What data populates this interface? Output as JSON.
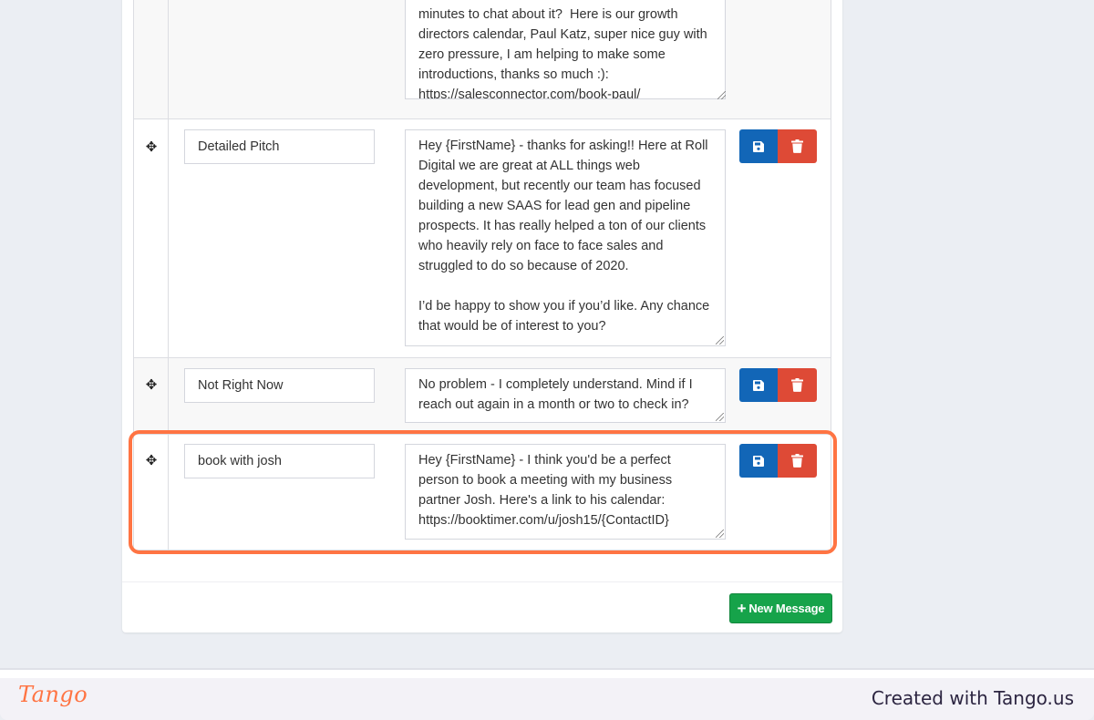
{
  "messages": [
    {
      "name": "",
      "body": "minutes to chat about it?  Here is our growth\ndirectors calendar, Paul Katz, super nice guy with\nzero pressure, I am helping to make some\nintroductions, thanks so much :):\nhttps://salesconnector.com/book-paul/"
    },
    {
      "name": "Detailed Pitch",
      "body": "Hey {FirstName} - thanks for asking!! Here at Roll Digital we are great at ALL things web development, but recently our team has focused building a new SAAS for lead gen and pipeline prospects. It has really helped a ton of our clients who heavily rely on face to face sales and struggled to do so because of 2020.\n\nI’d be happy to show you if you’d like. Any chance that would be of interest to you?"
    },
    {
      "name": "Not Right Now",
      "body": "No problem - I completely understand. Mind if I reach out again in a month or two to check in?"
    },
    {
      "name": "book with josh",
      "body": "Hey {FirstName} - I think you'd be a perfect person to book a meeting with my business partner Josh. Here's a link to his calendar: https://booktimer.com/u/josh15/{ContactID}"
    }
  ],
  "icons": {
    "move": "move-arrows-icon",
    "save": "floppy-disk-icon",
    "delete": "trash-icon",
    "add": "plus-icon"
  },
  "buttons": {
    "new_message": "New Message",
    "new_message_plus": "+"
  },
  "footer": {
    "logo": "Tango",
    "credit": "Created with Tango.us"
  },
  "colors": {
    "save": "#1266b7",
    "delete": "#de4a36",
    "new_message": "#16a34a",
    "highlight": "#ff7443"
  }
}
